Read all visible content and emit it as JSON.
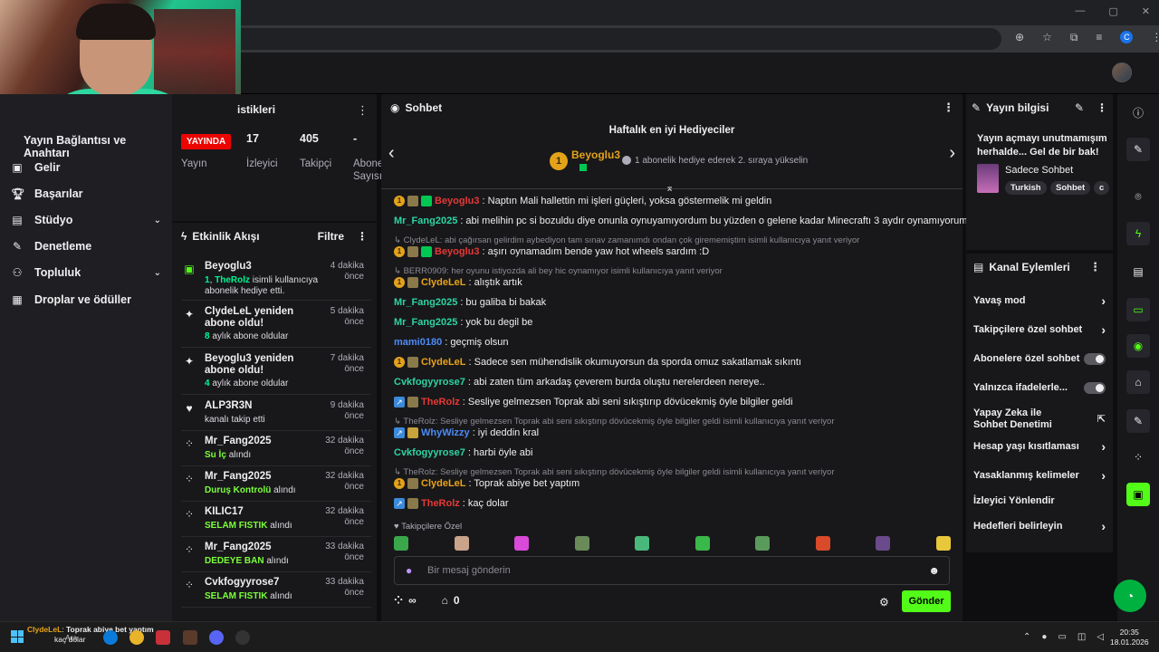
{
  "browser": {
    "window_controls": [
      "—",
      "▢",
      "✕"
    ],
    "toolbar_icons": [
      "⊕",
      "☆",
      "⧉",
      "≡",
      "C",
      "⋮"
    ]
  },
  "leftnav": {
    "section_title": "Yayın Bağlantısı ve Anahtarı",
    "items": [
      {
        "label": "Gelir",
        "icon": "money-icon"
      },
      {
        "label": "Başarılar",
        "icon": "trophy-icon"
      },
      {
        "label": "Stüdyo",
        "icon": "studio-icon",
        "expandable": true
      },
      {
        "label": "Denetleme",
        "icon": "wrench-icon"
      },
      {
        "label": "Topluluk",
        "icon": "community-icon",
        "expandable": true
      },
      {
        "label": "Droplar ve ödüller",
        "icon": "gift-icon"
      }
    ]
  },
  "stats": {
    "title": "istikleri",
    "live": "YAYINDA",
    "status_label": "Yayın",
    "viewers": {
      "value": "17",
      "label": "İzleyici"
    },
    "followers": {
      "value": "405",
      "label": "Takipçi"
    },
    "subs": {
      "value": "-",
      "label": "Abone Sayısı"
    }
  },
  "feed": {
    "title": "Etkinlik Akışı",
    "filter": "Filtre",
    "items": [
      {
        "name": "Beyoglu3",
        "time": "4 dakika önce",
        "count": "1",
        "user": "TheRolz",
        "desc": "isimli kullanıcıya abonelik hediye etti.",
        "icon": "gift-sub-icon"
      },
      {
        "name": "ClydeLeL yeniden abone oldu!",
        "time": "5 dakika önce",
        "count": "8",
        "desc": "aylık abone oldular",
        "icon": "sparkle-icon"
      },
      {
        "name": "Beyoglu3 yeniden abone oldu!",
        "time": "7 dakika önce",
        "count": "4",
        "desc": "aylık abone oldular",
        "icon": "sparkle-icon"
      },
      {
        "name": "ALP3R3N",
        "time": "9 dakika önce",
        "desc": "kanalı takip etti",
        "icon": "heart-icon"
      },
      {
        "name": "Mr_Fang2025",
        "time": "32 dakika önce",
        "reward": "Su İç",
        "desc": "alındı",
        "icon": "points-icon"
      },
      {
        "name": "Mr_Fang2025",
        "time": "32 dakika önce",
        "reward": "Duruş Kontrolü",
        "desc": "alındı",
        "icon": "points-icon"
      },
      {
        "name": "KILIC17",
        "time": "32 dakika önce",
        "reward": "SELAM FISTIK",
        "desc": "alındı",
        "icon": "points-icon"
      },
      {
        "name": "Mr_Fang2025",
        "time": "33 dakika önce",
        "reward": "DEDEYE BAN",
        "desc": "alındı",
        "icon": "points-icon"
      },
      {
        "name": "Cvkfogyyrose7",
        "time": "33 dakika önce",
        "reward": "SELAM FISTIK",
        "desc": "alındı",
        "icon": "points-icon"
      }
    ]
  },
  "chat": {
    "title": "Sohbet",
    "leader_title": "Haftalık en iyi Hediyeciler",
    "leader_rank": "1",
    "leader_name": "Beyoglu3",
    "leader_note": "1 abonelik hediye ederek 2. sıraya yükselin",
    "messages": [
      {
        "type": "msg",
        "user": "Beyoglu3",
        "color": "#e53935",
        "badges": [
          "gold1",
          "sub",
          "gift"
        ],
        "text": ": Naptın Mali hallettin mi işleri güçleri, yoksa göstermelik mi geldin"
      },
      {
        "type": "msg",
        "user": "Mr_Fang2025",
        "color": "#2dd4a0",
        "badges": [],
        "text": ": abi melihin pc si bozuldu diye onunla oynuyamıyordum bu yüzden o gelene kadar Minecraftı 3 aydır oynamıyorum :("
      },
      {
        "type": "reply",
        "text": "↳ ClydeLeL: abi çağırsan gelirdim aybediyon tam sınav zamanımdı ondan çok girememiştim isimli kullanıcıya yanıt veriyor"
      },
      {
        "type": "msg",
        "user": "Beyoglu3",
        "color": "#e53935",
        "badges": [
          "gold1",
          "sub",
          "gift"
        ],
        "text": ": aşırı oynamadım bende yaw hot wheels sardım :D"
      },
      {
        "type": "reply",
        "text": "↳ BERR0909: her oyunu istiyozda ali bey hic oynamıyor isimli kullanıcıya yanıt veriyor"
      },
      {
        "type": "msg",
        "user": "ClydeLeL",
        "color": "#e8a317",
        "badges": [
          "gold1",
          "sub"
        ],
        "text": ": alıştık artık"
      },
      {
        "type": "msg",
        "user": "Mr_Fang2025",
        "color": "#2dd4a0",
        "badges": [],
        "text": ": bu galiba bi bakak"
      },
      {
        "type": "msg",
        "user": "Mr_Fang2025",
        "color": "#2dd4a0",
        "badges": [],
        "text": ": yok bu degil be"
      },
      {
        "type": "msg",
        "user": "mami0180",
        "color": "#4d8bf5",
        "badges": [],
        "text": ": geçmiş olsun"
      },
      {
        "type": "msg",
        "user": "ClydeLeL",
        "color": "#e8a317",
        "badges": [
          "gold1",
          "sub"
        ],
        "text": ": Sadece sen mühendislik okumuyorsun da sporda omuz sakatlamak sıkıntı"
      },
      {
        "type": "msg",
        "user": "Cvkfogyyrose7",
        "color": "#2dd4a0",
        "badges": [],
        "text": ": abi zaten tüm arkadaş çeverem burda oluştu nerelerdeen nereye.."
      },
      {
        "type": "msg",
        "user": "TheRolz",
        "color": "#e53935",
        "badges": [
          "arrow",
          "sub"
        ],
        "text": ": Sesliye gelmezsen Toprak abi seni sıkıştırıp dövücekmiş öyle bilgiler geldi"
      },
      {
        "type": "reply",
        "text": "↳ TheRolz: Sesliye gelmezsen Toprak abi seni sıkıştırıp dövücekmiş öyle bilgiler geldi isimli kullanıcıya yanıt veriyor"
      },
      {
        "type": "msg",
        "user": "WhyWizzy",
        "color": "#4d8bf5",
        "badges": [
          "arrow",
          "crown"
        ],
        "text": ": iyi deddin kral"
      },
      {
        "type": "msg",
        "user": "Cvkfogyyrose7",
        "color": "#2dd4a0",
        "badges": [],
        "text": ": harbi öyle abi"
      },
      {
        "type": "reply",
        "text": "↳ TheRolz: Sesliye gelmezsen Toprak abi seni sıkıştırıp dövücekmiş öyle bilgiler geldi isimli kullanıcıya yanıt veriyor"
      },
      {
        "type": "msg",
        "user": "ClydeLeL",
        "color": "#e8a317",
        "badges": [
          "gold1",
          "sub"
        ],
        "text": ": Toprak abiye bet yaptım"
      },
      {
        "type": "msg",
        "user": "TheRolz",
        "color": "#e53935",
        "badges": [
          "arrow",
          "sub"
        ],
        "text": ": kaç dolar"
      }
    ],
    "followers_only": "Takipçilere Özel",
    "emote_colors": [
      "#3aa84a",
      "#c9a38a",
      "#d94ad9",
      "#6a8a5a",
      "#4ab87a",
      "#3ab84a",
      "#5a9a5a",
      "#d84a2a",
      "#6a4a8a",
      "#e8c83a"
    ],
    "input_placeholder": "Bir mesaj gönderin",
    "points": "∞",
    "shop_count": "0",
    "send": "Gönder"
  },
  "info": {
    "title": "Yayın bilgisi",
    "text": "Yayın açmayı unutmamışım herhalde... Gel de bir bak!",
    "category": "Sadece Sohbet",
    "tags": [
      "Turkish",
      "Sohbet",
      "c"
    ]
  },
  "actions": {
    "title": "Kanal Eylemleri",
    "items": [
      {
        "label": "Yavaş mod",
        "kind": "arrow"
      },
      {
        "label": "Takipçilere özel sohbet",
        "kind": "arrow"
      },
      {
        "label": "Abonelere özel sohbet",
        "kind": "toggle"
      },
      {
        "label": "Yalnızca ifadelerle...",
        "kind": "toggle"
      },
      {
        "label": "Yapay Zeka ile Sohbet Denetimi",
        "kind": "external"
      },
      {
        "label": "Hesap yaşı kısıtlaması",
        "kind": "arrow"
      },
      {
        "label": "Yasaklanmış kelimeler",
        "kind": "arrow"
      },
      {
        "label": "İzleyici Yönlendir",
        "kind": "none"
      },
      {
        "label": "Hedefleri belirleyin",
        "kind": "arrow"
      }
    ]
  },
  "rail": [
    "info-icon",
    "pencil-icon",
    "camera-icon",
    "bolt-icon",
    "document-icon",
    "chat-icon",
    "broadcast-icon",
    "store-icon",
    "wrench-icon",
    "points-icon",
    "app-icon"
  ],
  "taskbar": {
    "notif_user": "ClydeLeL",
    "notif_text": "Toprak abiye bet yaptım",
    "notif_user2": "TheRolz",
    "notif_text2": "kaç dolar",
    "search": "Ara",
    "time": "20:35",
    "date": "18.01.2026"
  }
}
